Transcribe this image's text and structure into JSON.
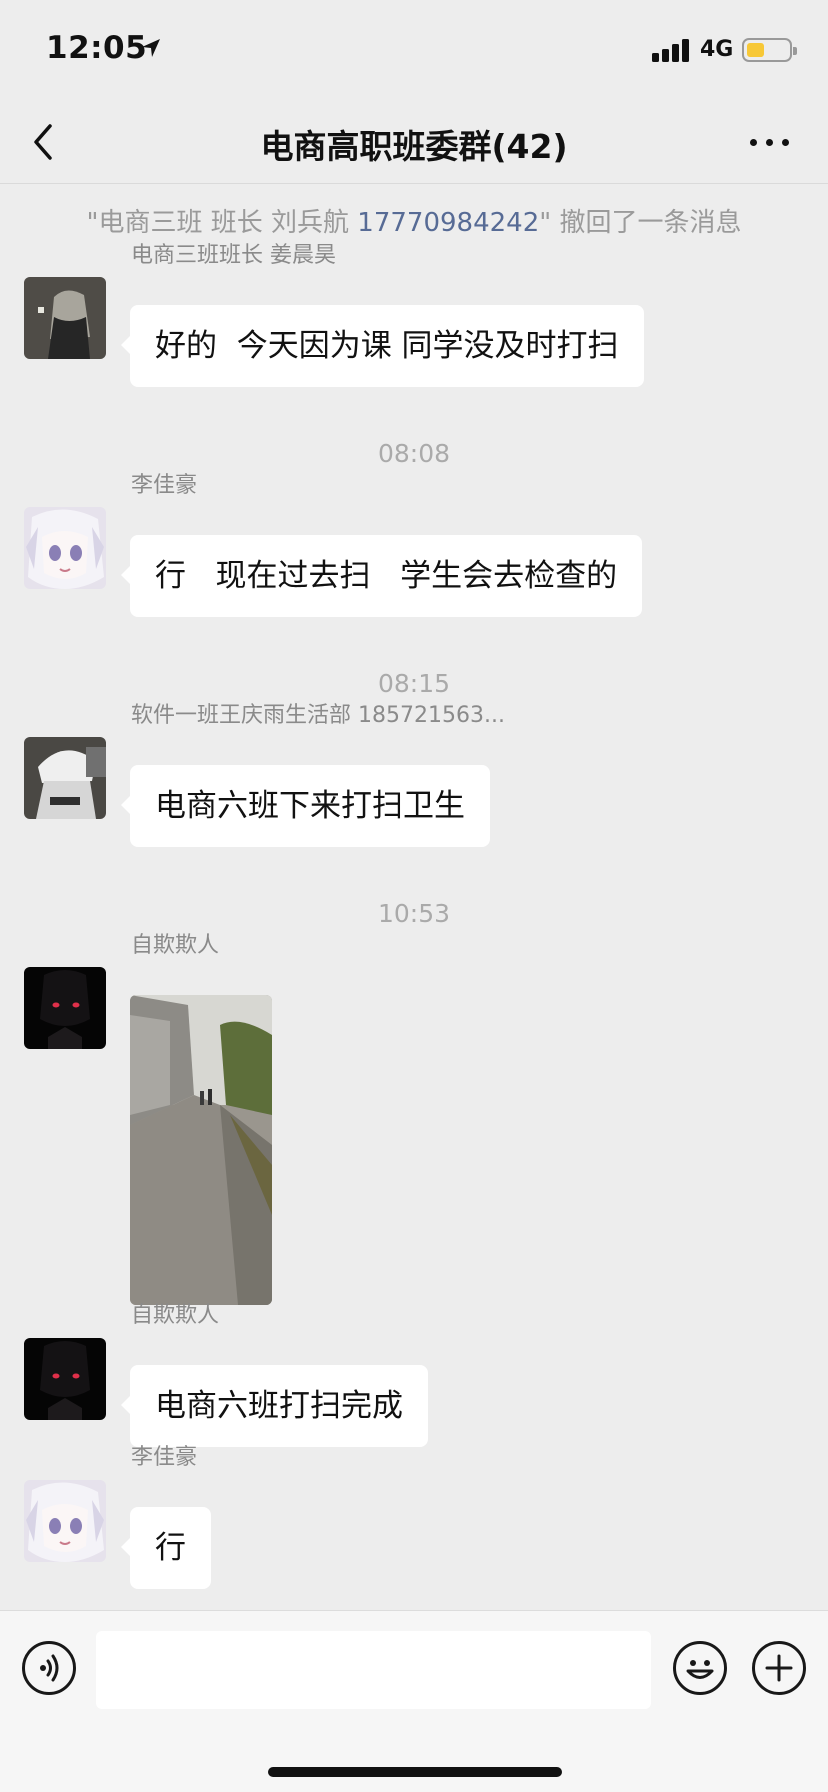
{
  "status_bar": {
    "time": "12:05",
    "network": "4G",
    "icons": [
      "location-arrow-icon",
      "signal-bars-icon",
      "battery-icon"
    ],
    "battery_color": "#f7c837"
  },
  "header": {
    "title": "电商高职班委群(42)",
    "icons": [
      "back-chevron-icon",
      "more-dots-icon"
    ]
  },
  "system_message": {
    "prefix": "\"电商三班 班长 刘兵航 ",
    "phone": "17770984242",
    "suffix": "\" 撤回了一条消息",
    "link_color": "#576b95"
  },
  "messages": [
    {
      "sender": "电商三班班长 姜晨昊",
      "text": "好的  今天因为课 同学没及时打扫"
    },
    {
      "timestamp": "08:08"
    },
    {
      "sender": "李佳豪",
      "text": "行   现在过去扫   学生会去检查的"
    },
    {
      "timestamp": "08:15"
    },
    {
      "sender": "软件一班王庆雨生活部 185721563...",
      "text": "电商六班下来打扫卫生"
    },
    {
      "timestamp": "10:53"
    },
    {
      "sender": "自欺欺人",
      "image": "street-photo"
    },
    {
      "sender": "自欺欺人",
      "text": "电商六班打扫完成"
    },
    {
      "sender": "李佳豪",
      "text": "行"
    }
  ],
  "input_bar": {
    "placeholder": "",
    "icons": [
      "voice-icon",
      "emoji-icon",
      "plus-icon"
    ]
  },
  "colors": {
    "background": "#ededed",
    "bubble": "#ffffff",
    "input_bar": "#f6f6f6"
  }
}
